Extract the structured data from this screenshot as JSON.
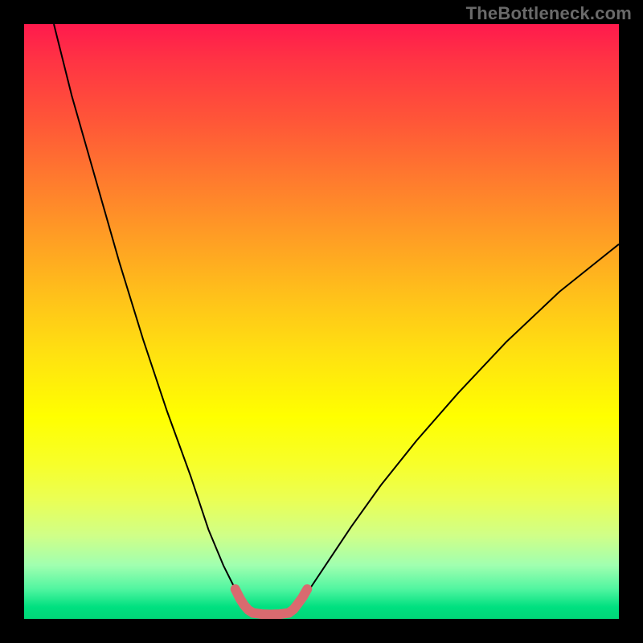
{
  "watermark": "TheBottleneck.com",
  "chart_data": {
    "type": "line",
    "title": "",
    "xlabel": "",
    "ylabel": "",
    "xlim": [
      0,
      100
    ],
    "ylim": [
      0,
      100
    ],
    "grid": false,
    "series": [
      {
        "name": "curve-left",
        "color": "#000000",
        "width": 2,
        "x": [
          5,
          8,
          12,
          16,
          20,
          24,
          28,
          31,
          33.5,
          35.5,
          37
        ],
        "y": [
          100,
          88,
          74,
          60,
          47,
          35,
          24,
          15,
          9,
          5,
          2.5
        ]
      },
      {
        "name": "curve-right",
        "color": "#000000",
        "width": 2,
        "x": [
          46,
          48,
          51,
          55,
          60,
          66,
          73,
          81,
          90,
          100
        ],
        "y": [
          2.5,
          5,
          9.5,
          15.5,
          22.5,
          30,
          38,
          46.5,
          55,
          63
        ]
      },
      {
        "name": "highlight-left",
        "color": "#d96a6f",
        "width": 12,
        "linecap": "round",
        "x": [
          35.5,
          36.3,
          37,
          37.7,
          38.5
        ],
        "y": [
          5,
          3.4,
          2.3,
          1.5,
          1.0
        ]
      },
      {
        "name": "highlight-bottom",
        "color": "#d96a6f",
        "width": 12,
        "linecap": "round",
        "x": [
          38.5,
          40,
          41.5,
          43,
          44.5
        ],
        "y": [
          1.0,
          0.8,
          0.75,
          0.8,
          1.0
        ]
      },
      {
        "name": "highlight-right",
        "color": "#d96a6f",
        "width": 12,
        "linecap": "round",
        "x": [
          44.5,
          45.3,
          46,
          46.8,
          47.6
        ],
        "y": [
          1.0,
          1.6,
          2.5,
          3.6,
          5
        ]
      }
    ]
  }
}
